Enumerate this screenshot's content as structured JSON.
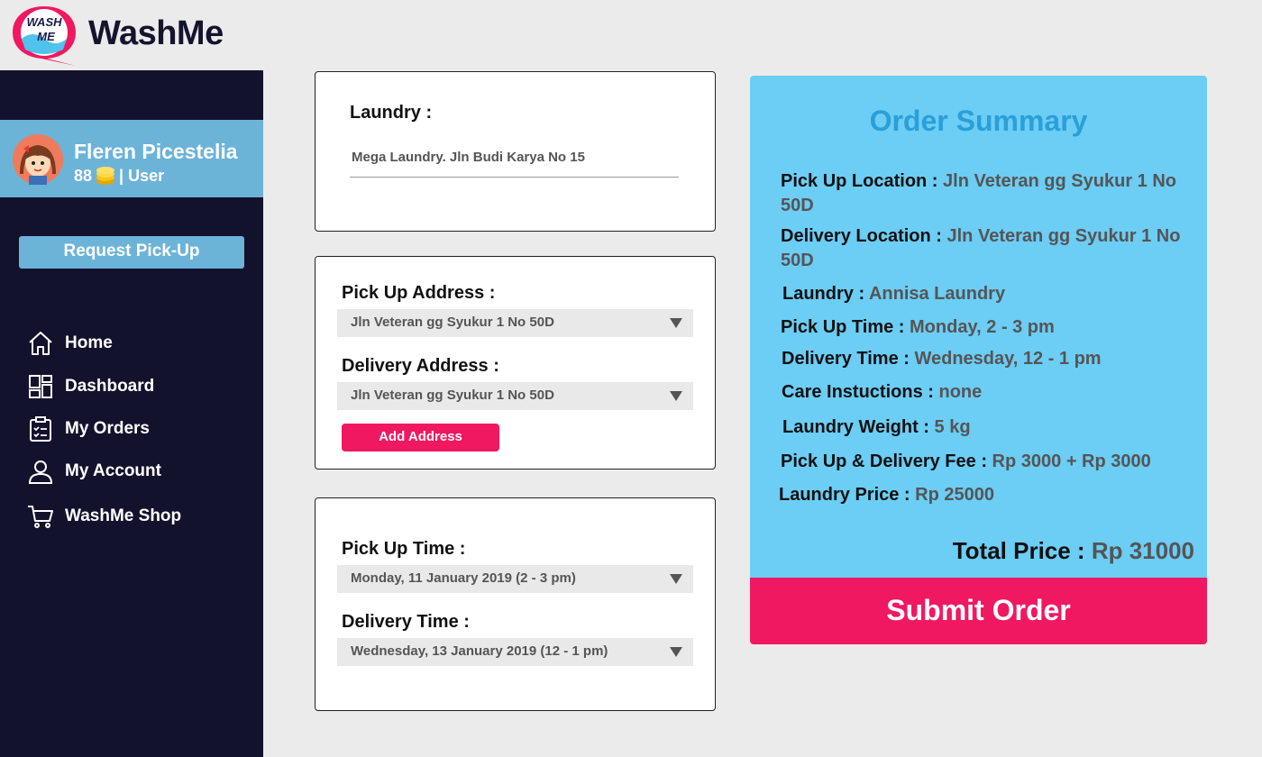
{
  "app": {
    "brand": "WashMe",
    "logo_text_top": "WASH",
    "logo_text_bottom": "ME"
  },
  "colors": {
    "sidebar": "#13122d",
    "accent_blue": "#6cb3d8",
    "summary_bg": "#6ccdf5",
    "primary_pink": "#f01861",
    "summary_title": "#2a9fd8"
  },
  "user": {
    "name": "Fleren Picestelia",
    "coins": "88",
    "role": "| User"
  },
  "sidebar": {
    "request_button": "Request Pick-Up",
    "items": [
      {
        "label": "Home",
        "icon": "home-icon"
      },
      {
        "label": "Dashboard",
        "icon": "dashboard-icon"
      },
      {
        "label": "My Orders",
        "icon": "orders-icon"
      },
      {
        "label": "My Account",
        "icon": "account-icon"
      },
      {
        "label": "WashMe Shop",
        "icon": "cart-icon"
      }
    ]
  },
  "form": {
    "laundry_label": "Laundry :",
    "laundry_value": "Mega Laundry. Jln Budi Karya No 15",
    "pickup_address_label": "Pick Up Address :",
    "pickup_address_value": "Jln Veteran gg Syukur 1 No 50D",
    "delivery_address_label": "Delivery Address :",
    "delivery_address_value": "Jln Veteran gg Syukur 1 No 50D",
    "add_address_button": "Add Address",
    "pickup_time_label": "Pick Up Time :",
    "pickup_time_value": "Monday, 11 January 2019 (2 - 3 pm)",
    "delivery_time_label": "Delivery Time :",
    "delivery_time_value": "Wednesday, 13 January 2019 (12 - 1 pm)"
  },
  "summary": {
    "title": "Order Summary",
    "rows": [
      {
        "label": "Pick Up Location : ",
        "value": "Jln Veteran gg Syukur 1 No 50D"
      },
      {
        "label": "Delivery Location : ",
        "value": "Jln Veteran gg Syukur 1 No 50D"
      },
      {
        "label": "Laundry : ",
        "value": "Annisa Laundry"
      },
      {
        "label": "Pick Up Time : ",
        "value": "Monday, 2 - 3 pm"
      },
      {
        "label": "Delivery Time : ",
        "value": "Wednesday, 12 - 1 pm"
      },
      {
        "label": "Care Instuctions : ",
        "value": "none"
      },
      {
        "label": "Laundry Weight : ",
        "value": "5 kg"
      },
      {
        "label": "Pick Up & Delivery Fee : ",
        "value": "Rp 3000 + Rp 3000"
      },
      {
        "label": "Laundry Price : ",
        "value": "Rp 25000"
      }
    ],
    "total_label": "Total Price : ",
    "total_value": "Rp 31000",
    "submit_button": "Submit Order"
  }
}
